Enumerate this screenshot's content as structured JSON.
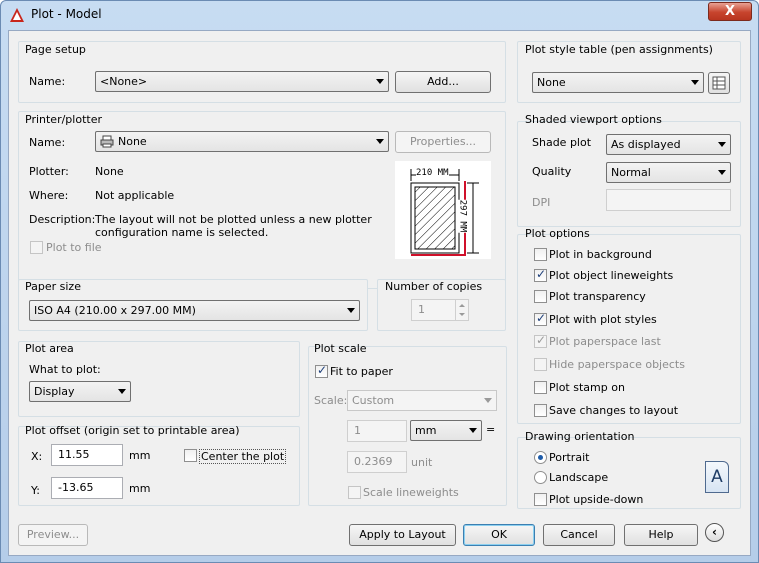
{
  "window": {
    "title": "Plot - Model",
    "close": "X"
  },
  "page_setup": {
    "group": "Page setup",
    "name_label": "Name:",
    "name_value": "<None>",
    "add_button": "Add..."
  },
  "printer": {
    "group": "Printer/plotter",
    "name_label": "Name:",
    "name_value": "None",
    "properties_button": "Properties...",
    "plotter_label": "Plotter:",
    "plotter_value": "None",
    "where_label": "Where:",
    "where_value": "Not applicable",
    "description_label": "Description:",
    "description_line1": "The layout will not be plotted unless a new plotter",
    "description_line2": "configuration name is selected.",
    "plot_to_file": "Plot to file",
    "preview_width": "210 MM",
    "preview_height": "297 MM"
  },
  "paper_size": {
    "group": "Paper size",
    "value": "ISO A4 (210.00 x 297.00 MM)"
  },
  "copies": {
    "group": "Number of copies",
    "value": "1"
  },
  "plot_area": {
    "group": "Plot area",
    "what_label": "What to plot:",
    "what_value": "Display"
  },
  "plot_offset": {
    "group": "Plot offset (origin set to printable area)",
    "x_label": "X:",
    "x_value": "11.55",
    "x_unit": "mm",
    "y_label": "Y:",
    "y_value": "-13.65",
    "y_unit": "mm",
    "center": "Center the plot"
  },
  "plot_scale": {
    "group": "Plot scale",
    "fit": "Fit to paper",
    "scale_label": "Scale:",
    "scale_value": "Custom",
    "value1": "1",
    "unit_value": "mm",
    "equals": "=",
    "value2": "0.2369",
    "unit_label": "unit",
    "scale_lineweights": "Scale lineweights"
  },
  "bottom": {
    "preview": "Preview...",
    "apply": "Apply to Layout",
    "ok": "OK",
    "cancel": "Cancel",
    "help": "Help"
  },
  "pen": {
    "group": "Plot style table (pen assignments)",
    "value": "None"
  },
  "shaded": {
    "group": "Shaded viewport options",
    "shade_label": "Shade plot",
    "shade_value": "As displayed",
    "quality_label": "Quality",
    "quality_value": "Normal",
    "dpi_label": "DPI"
  },
  "plot_options": {
    "group": "Plot options",
    "items": [
      "Plot in background",
      "Plot object lineweights",
      "Plot transparency",
      "Plot with plot styles",
      "Plot paperspace last",
      "Hide paperspace objects",
      "Plot stamp on",
      "Save changes to layout"
    ]
  },
  "orientation": {
    "group": "Drawing orientation",
    "portrait": "Portrait",
    "landscape": "Landscape",
    "upside_down": "Plot upside-down",
    "icon_letter": "A"
  }
}
